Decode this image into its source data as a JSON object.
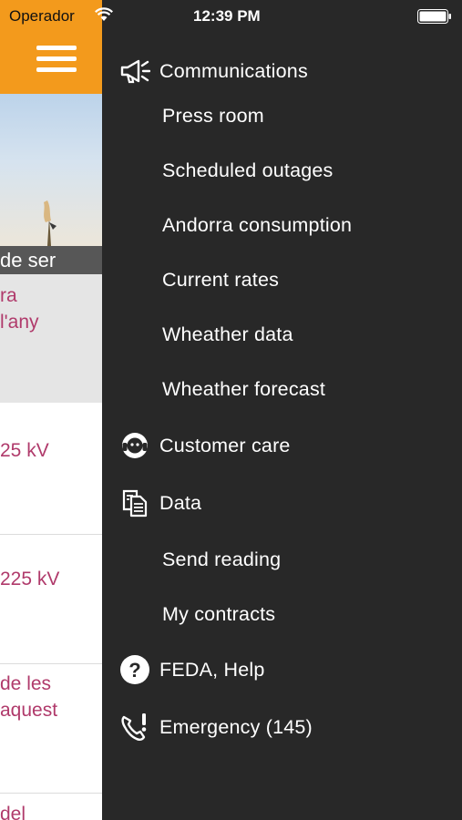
{
  "status_bar": {
    "carrier": "Operador",
    "time": "12:39 PM"
  },
  "background": {
    "caption": "de ser",
    "news": [
      {
        "lines": [
          "ra",
          "l'any"
        ]
      },
      {
        "lines": [
          "25 kV"
        ]
      },
      {
        "lines": [
          "225 kV"
        ]
      },
      {
        "lines": [
          "de les",
          "aquest"
        ]
      },
      {
        "lines": [
          "del"
        ]
      }
    ]
  },
  "drawer": {
    "menu": [
      {
        "kind": "section",
        "label": "Communications",
        "icon": "megaphone-icon"
      },
      {
        "kind": "sub",
        "label": "Press room"
      },
      {
        "kind": "sub",
        "label": "Scheduled outages"
      },
      {
        "kind": "sub",
        "label": "Andorra consumption"
      },
      {
        "kind": "sub",
        "label": "Current rates"
      },
      {
        "kind": "sub",
        "label": "Wheather data"
      },
      {
        "kind": "sub",
        "label": "Wheather forecast"
      },
      {
        "kind": "section",
        "label": "Customer care",
        "icon": "headset-agent-icon"
      },
      {
        "kind": "section",
        "label": "Data",
        "icon": "documents-icon"
      },
      {
        "kind": "sub",
        "label": "Send reading"
      },
      {
        "kind": "sub",
        "label": "My contracts"
      },
      {
        "kind": "section",
        "label": "FEDA, Help",
        "icon": "question-circle-icon"
      },
      {
        "kind": "section",
        "label": "Emergency (145)",
        "icon": "phone-alert-icon"
      }
    ]
  },
  "colors": {
    "header_orange": "#f39a1c",
    "drawer_bg": "#282828",
    "link_magenta": "#b03a6b"
  }
}
